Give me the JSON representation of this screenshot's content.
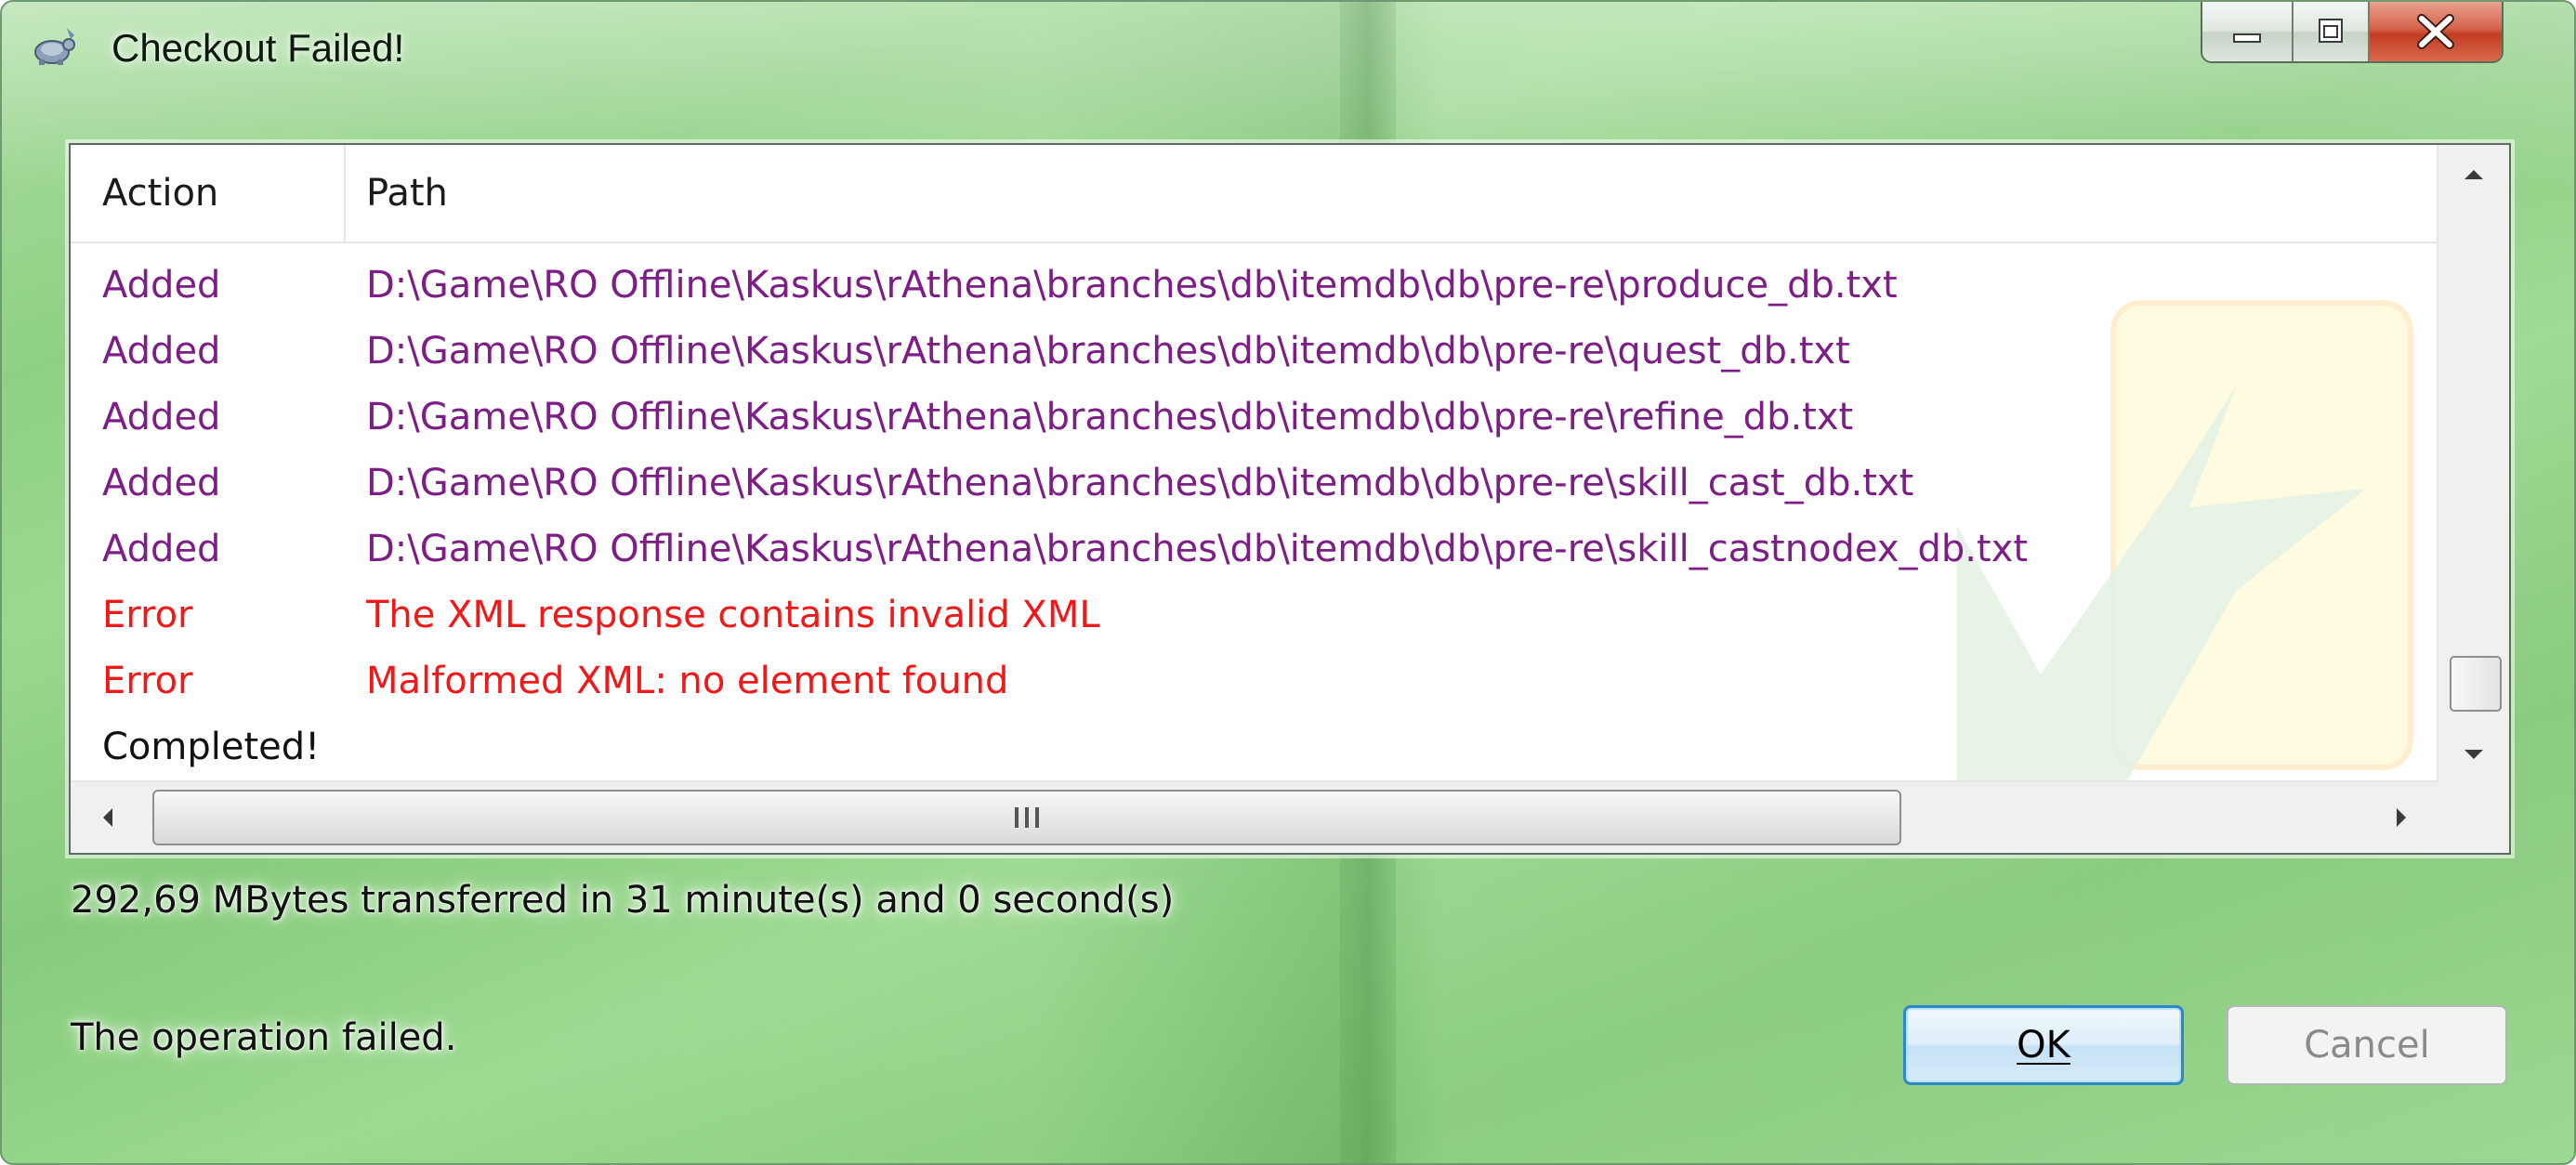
{
  "window": {
    "title": "Checkout Failed!",
    "app_icon": "tortoisesvn-icon",
    "caption_buttons": [
      "minimize",
      "maximize",
      "close"
    ]
  },
  "list": {
    "columns": [
      "Action",
      "Path"
    ],
    "rows": [
      {
        "action": "Added",
        "path": "D:\\Game\\RO Offline\\Kaskus\\rAthena\\branches\\db\\itemdb\\db\\pre-re\\produce_db.txt",
        "kind": "added"
      },
      {
        "action": "Added",
        "path": "D:\\Game\\RO Offline\\Kaskus\\rAthena\\branches\\db\\itemdb\\db\\pre-re\\quest_db.txt",
        "kind": "added"
      },
      {
        "action": "Added",
        "path": "D:\\Game\\RO Offline\\Kaskus\\rAthena\\branches\\db\\itemdb\\db\\pre-re\\refine_db.txt",
        "kind": "added"
      },
      {
        "action": "Added",
        "path": "D:\\Game\\RO Offline\\Kaskus\\rAthena\\branches\\db\\itemdb\\db\\pre-re\\skill_cast_db.txt",
        "kind": "added"
      },
      {
        "action": "Added",
        "path": "D:\\Game\\RO Offline\\Kaskus\\rAthena\\branches\\db\\itemdb\\db\\pre-re\\skill_castnodex_db.txt",
        "kind": "added"
      },
      {
        "action": "Error",
        "path": "The XML response contains invalid XML",
        "kind": "error"
      },
      {
        "action": "Error",
        "path": "Malformed XML: no element found",
        "kind": "error"
      },
      {
        "action": "Completed!",
        "path": "",
        "kind": "done"
      }
    ],
    "colors": {
      "added": "#7d1d86",
      "error": "#f01818",
      "done": "#111111"
    }
  },
  "status": {
    "transfer": "292,69 MBytes transferred in 31 minute(s) and 0 second(s)",
    "operation": "The operation failed."
  },
  "buttons": {
    "ok_label": "OK",
    "cancel_label": "Cancel"
  }
}
